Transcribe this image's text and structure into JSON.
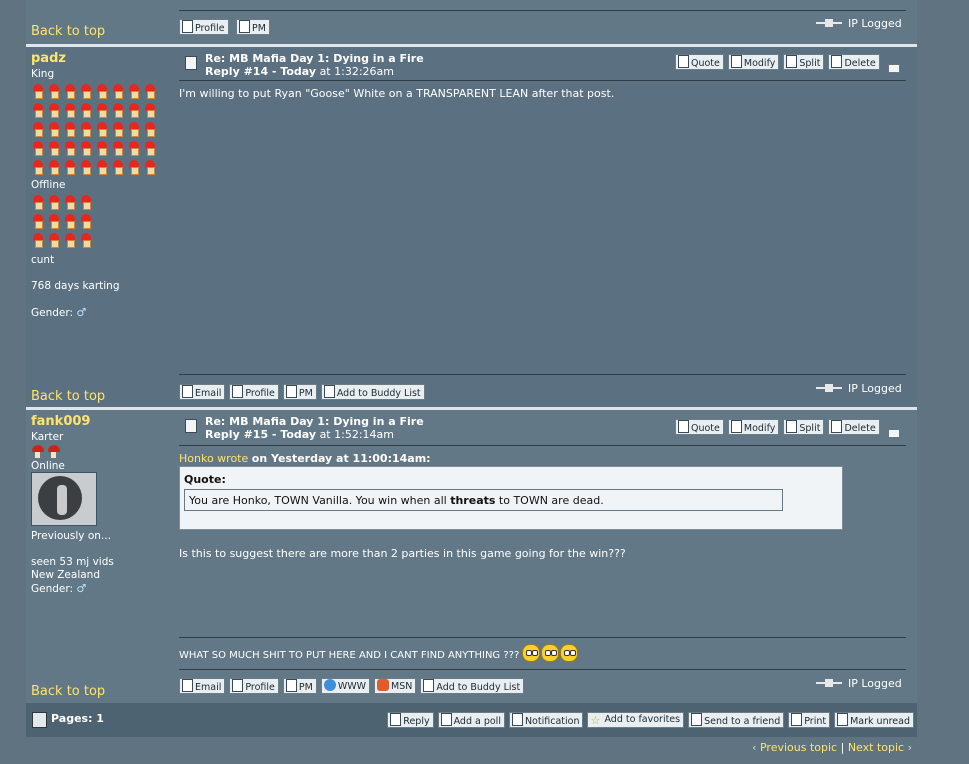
{
  "prev_post": {
    "back_to_top": "Back to top",
    "buttons": [
      "Profile",
      "PM"
    ],
    "ip_logged": "IP Logged"
  },
  "post14": {
    "username": "padz",
    "rank": "King",
    "status": "Offline",
    "personal_text": "cunt",
    "custom_line": "768 days karting",
    "gender_label": "Gender:",
    "subject": "Re: MB Mafia Day 1: Dying in a Fire",
    "reply_label": "Reply #14 - Today",
    "reply_time": "at 1:32:26am",
    "actions": [
      "Quote",
      "Modify",
      "Split",
      "Delete"
    ],
    "body": "I'm willing to put Ryan \"Goose\" White on a TRANSPARENT LEAN after that post.",
    "footer_buttons": [
      "Email",
      "Profile",
      "PM",
      "Add to Buddy List"
    ],
    "ip_logged": "IP Logged",
    "back_to_top": "Back to top"
  },
  "post15": {
    "username": "fank009",
    "rank": "Karter",
    "status": "Online",
    "personal_text": "Previously on...",
    "custom_line": "seen 53 mj vids",
    "location": "New Zealand",
    "gender_label": "Gender:",
    "subject": "Re: MB Mafia Day 1: Dying in a Fire",
    "reply_label": "Reply #15 - Today",
    "reply_time": "at 1:52:14am",
    "actions": [
      "Quote",
      "Modify",
      "Split",
      "Delete"
    ],
    "quote_author": "Honko wrote",
    "quote_when": "on Yesterday at 11:00:14am:",
    "quote_label": "Quote:",
    "quote_text_pre": "You are Honko, TOWN Vanilla. You win when all ",
    "quote_text_bold": "threats",
    "quote_text_post": " to TOWN are dead.",
    "body": "Is this to suggest there are more than 2 parties in this game going for the win???",
    "signature": "WHAT SO MUCH SHIT TO PUT HERE AND I CANT FIND ANYTHING ???",
    "footer_buttons": [
      "Email",
      "Profile",
      "PM",
      "WWW",
      "MSN",
      "Add to Buddy List"
    ],
    "ip_logged": "IP Logged",
    "back_to_top": "Back to top"
  },
  "bottom": {
    "pages_label": "Pages: 1",
    "actions": [
      "Reply",
      "Add a poll",
      "Notification",
      "Add to favorites",
      "Send to a friend",
      "Print",
      "Mark unread"
    ],
    "prev_topic": "Previous topic",
    "next_topic": "Next topic",
    "separator": "|"
  }
}
